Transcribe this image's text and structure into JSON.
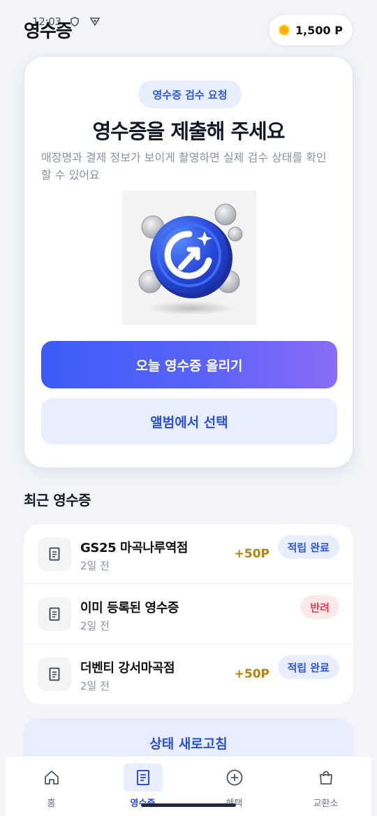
{
  "status_bar": {
    "time": "12:03"
  },
  "header": {
    "title": "영수증",
    "points": "1,500 P"
  },
  "hero": {
    "badge": "영수증 검수 요청",
    "heading": "영수증을 제출해 주세요",
    "description": "매장명과 결제 정보가 보이게 촬영하면 실제 검수 상태를 확인할 수 있어요",
    "primary_button": "오늘 영수증 올리기",
    "secondary_button": "앨범에서 선택"
  },
  "recent": {
    "title": "최근 영수증",
    "items": [
      {
        "name": "GS25 마곡나루역점",
        "time": "2일 전",
        "points": "+50P",
        "status": "적립 완료",
        "status_type": "ok"
      },
      {
        "name": "이미 등록된 영수증",
        "time": "2일 전",
        "points": "",
        "status": "반려",
        "status_type": "reject"
      },
      {
        "name": "더벤티 강서마곡점",
        "time": "2일 전",
        "points": "+50P",
        "status": "적립 완료",
        "status_type": "ok"
      }
    ]
  },
  "refresh_button": "상태 새로고침",
  "nav": {
    "items": [
      {
        "label": "홈",
        "icon": "home-icon"
      },
      {
        "label": "영수증",
        "icon": "receipt-icon"
      },
      {
        "label": "혜택",
        "icon": "plus-circle-icon"
      },
      {
        "label": "교환소",
        "icon": "shopping-bag-icon"
      }
    ],
    "active": "영수증"
  },
  "colors": {
    "accent": "#3c5cf6",
    "accent_light": "#e8eeff",
    "points_gold": "#b5830a",
    "reject_red": "#e0414f"
  }
}
